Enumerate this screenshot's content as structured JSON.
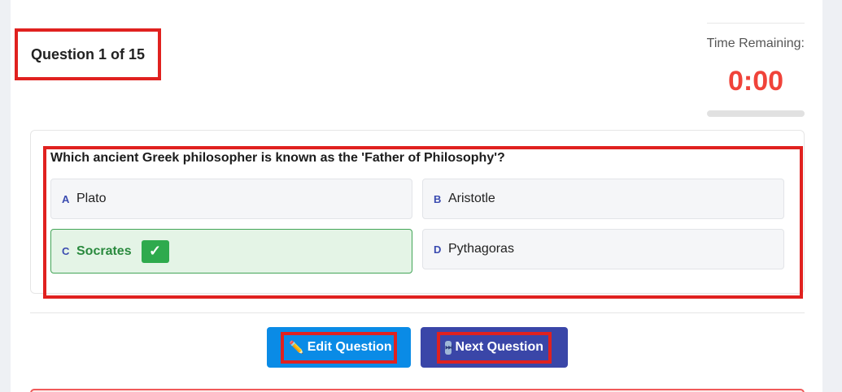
{
  "header": {
    "question_counter": "Question 1 of 15"
  },
  "timer": {
    "label": "Time Remaining:",
    "value": "0:00",
    "progress_fraction": 0
  },
  "question": {
    "text": "Which ancient Greek philosopher is known as the 'Father of Philosophy'?",
    "options": [
      {
        "letter": "A",
        "text": "Plato"
      },
      {
        "letter": "B",
        "text": "Aristotle"
      },
      {
        "letter": "C",
        "text": "Socrates"
      },
      {
        "letter": "D",
        "text": "Pythagoras"
      }
    ],
    "correct_mark": "✓"
  },
  "actions": {
    "edit_icon": "✏️",
    "edit_label": "Edit Question",
    "next_icon": "⏭",
    "next_label": "Next Question"
  },
  "colors": {
    "accent_red": "#f0433a",
    "correct_green": "#2eaa4d",
    "edit_blue": "#0a8be6",
    "next_indigo": "#3a46a8"
  }
}
